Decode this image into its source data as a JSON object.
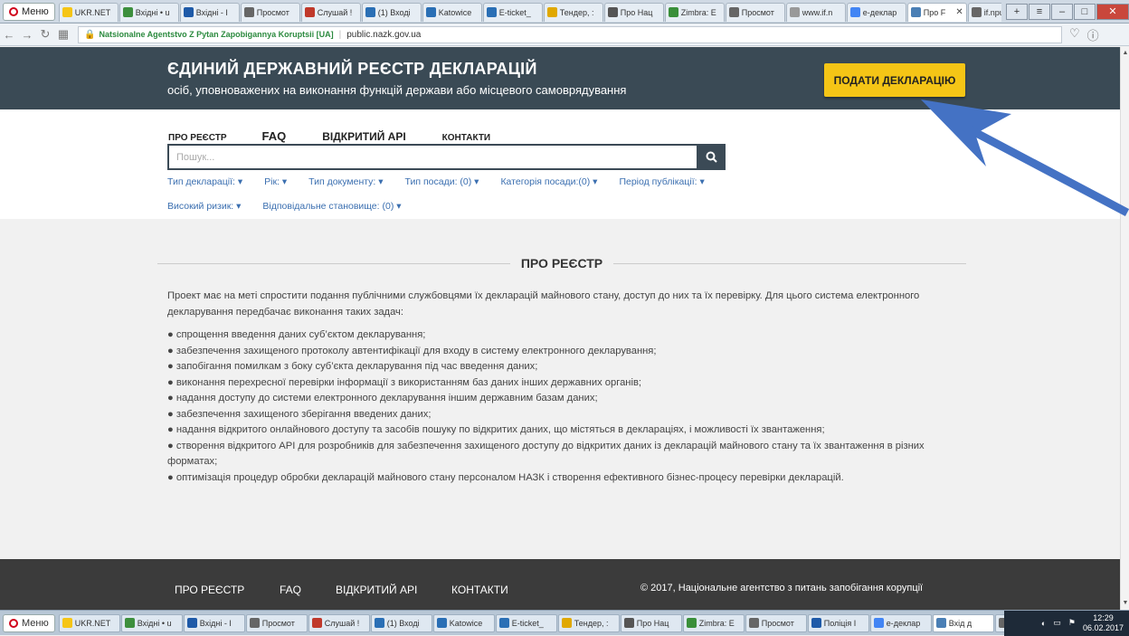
{
  "browser": {
    "menu_label": "Меню",
    "tabs": [
      {
        "label": "UKR.NET",
        "color": "#f5c516"
      },
      {
        "label": "Вхідні • u",
        "color": "#3d8f3d"
      },
      {
        "label": "Вхідні - I",
        "color": "#1e5aa8"
      },
      {
        "label": "Просмот",
        "color": "#666666"
      },
      {
        "label": "Слушай !",
        "color": "#c0392b"
      },
      {
        "label": "(1) Вході",
        "color": "#2a6fb5"
      },
      {
        "label": "Katowice",
        "color": "#2a6fb5"
      },
      {
        "label": "E-ticket_",
        "color": "#2a6fb5"
      },
      {
        "label": "Тендер, :",
        "color": "#e0a800"
      },
      {
        "label": "Про Нац",
        "color": "#555555"
      },
      {
        "label": "Zimbra: E",
        "color": "#3a8f3a"
      },
      {
        "label": "Просмот",
        "color": "#666666"
      },
      {
        "label": "www.if.n",
        "color": "#999999"
      },
      {
        "label": "е-деклар",
        "color": "#4285f4"
      },
      {
        "label": "Про F",
        "color": "#4a7fb5",
        "active": true
      },
      {
        "label": "if.npu.go",
        "color": "#666666"
      }
    ],
    "site_identity": "Natsionalne Agentstvo Z Pytan Zapobigannya Koruptsii [UA]",
    "url": "public.nazk.gov.ua"
  },
  "header": {
    "title": "ЄДИНИЙ ДЕРЖАВНИЙ РЕЄСТР ДЕКЛАРАЦІЙ",
    "subtitle": "осіб, уповноважених на виконання функцій держави або місцевого самоврядування",
    "submit_button": "ПОДАТИ ДЕКЛАРАЦІЮ"
  },
  "nav": {
    "about": "ПРО РЕЄСТР",
    "faq": "FAQ",
    "api": "ВІДКРИТИЙ API",
    "contacts": "КОНТАКТИ"
  },
  "search": {
    "placeholder": "Пошук..."
  },
  "filters_row1": [
    "Тип декларації: ▾",
    "Рік: ▾",
    "Тип документу: ▾",
    "Тип посади: (0) ▾",
    "Категорія посади:(0) ▾",
    "Період публікації: ▾"
  ],
  "filters_row2": [
    "Високий ризик: ▾",
    "Відповідальне становище: (0) ▾"
  ],
  "section": {
    "title": "ПРО РЕЄСТР",
    "intro": "Проект має на меті спростити подання публічними службовцями їх декларацій майнового стану, доступ до них та їх перевірку. Для цього система електронного декларування передбачає виконання таких задач:",
    "items": [
      "● спрощення введення даних суб’єктом декларування;",
      "● забезпечення захищеного протоколу автентифікації для входу в систему електронного декларування;",
      "● запобігання помилкам з боку суб’єкта декларування під час введення даних;",
      "● виконання перехресної перевірки інформації з використанням баз даних інших державних органів;",
      "● надання доступу до системи електронного декларування іншим державним базам даних;",
      "● забезпечення захищеного зберігання введених даних;",
      "● надання відкритого онлайнового доступу та засобів пошуку по відкритих даних, що містяться в деклараціях, і можливості їх звантаження;",
      "● створення відкритого API для розробників для забезпечення захищеного доступу до відкритих даних із декларацій майнового стану та їх звантаження в різних форматах;",
      "● оптимізація процедур обробки декларацій майнового стану персоналом НАЗК і створення ефективного бізнес-процесу перевірки декларацій."
    ]
  },
  "footer": {
    "about": "ПРО РЕЄСТР",
    "faq": "FAQ",
    "api": "ВІДКРИТИЙ API",
    "contacts": "КОНТАКТИ",
    "copyright": "© 2017, Національне агентство з питань запобігання корупції"
  },
  "taskbar": {
    "opera_label": "Меню",
    "items": [
      {
        "label": "UKR.NET",
        "color": "#f5c516"
      },
      {
        "label": "Вхідні • u",
        "color": "#3d8f3d"
      },
      {
        "label": "Вхідні - I",
        "color": "#1e5aa8"
      },
      {
        "label": "Просмот",
        "color": "#666666"
      },
      {
        "label": "Слушай !",
        "color": "#c0392b"
      },
      {
        "label": "(1) Вході",
        "color": "#2a6fb5"
      },
      {
        "label": "Katowice",
        "color": "#2a6fb5"
      },
      {
        "label": "E-ticket_",
        "color": "#2a6fb5"
      },
      {
        "label": "Тендер, :",
        "color": "#e0a800"
      },
      {
        "label": "Про Нац",
        "color": "#555555"
      },
      {
        "label": "Zimbra: E",
        "color": "#3a8f3a"
      },
      {
        "label": "Просмот",
        "color": "#666666"
      },
      {
        "label": "Поліція I",
        "color": "#1e5aa8"
      },
      {
        "label": "е-деклар",
        "color": "#4285f4"
      },
      {
        "label": "Вхід д",
        "color": "#4a7fb5",
        "active": true
      },
      {
        "label": "if.npu",
        "color": "#666666"
      }
    ],
    "time": "12:29",
    "date": "06.02.2017"
  },
  "colors": {
    "header_bg": "#3a4a55",
    "submit_yellow": "#f5c516",
    "link_blue": "#3b6fb0",
    "footer_bg": "#3b3b3b",
    "arrow_blue": "#4472c4"
  }
}
